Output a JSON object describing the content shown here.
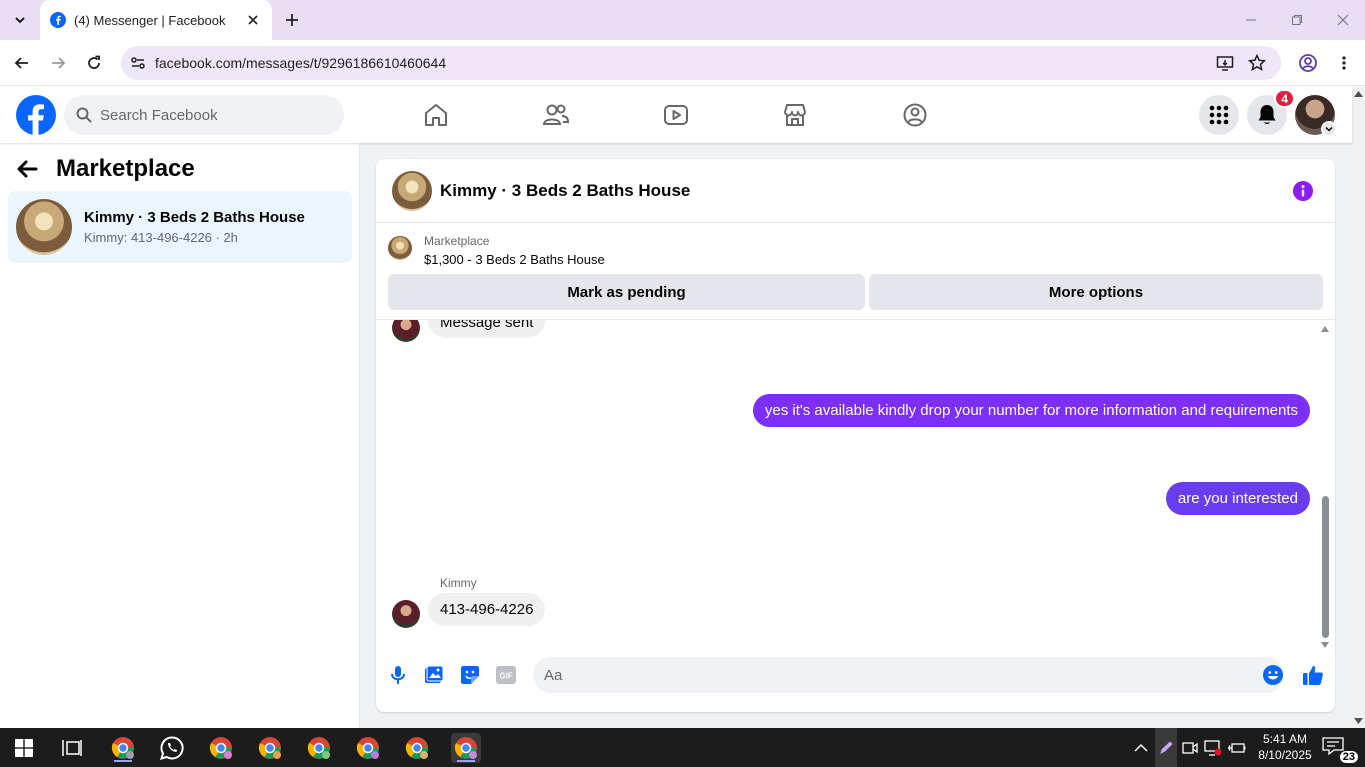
{
  "browser": {
    "tab_title": "(4) Messenger | Facebook",
    "url": "facebook.com/messages/t/9296186610460644"
  },
  "fb": {
    "search_placeholder": "Search Facebook",
    "notification_count": "4",
    "brand_color": "#0866ff"
  },
  "sidebar": {
    "title": "Marketplace",
    "conversation": {
      "name": "Kimmy · 3 Beds 2 Baths House",
      "snippet": "Kimmy: 413-496-4226 · 2h"
    }
  },
  "chat": {
    "title": "Kimmy · 3 Beds 2 Baths House",
    "listing_label": "Marketplace",
    "listing_price": "$1,300 - 3 Beds 2 Baths House",
    "mark_pending_label": "Mark as pending",
    "more_options_label": "More options",
    "accent_color": "#7b2ff7",
    "messages": {
      "partial_incoming": "Message sent",
      "outgoing_1": "yes it's available kindly drop your number for more information and requirements",
      "outgoing_2": "are you interested",
      "sender_name": "Kimmy",
      "incoming_last": "413-496-4226"
    },
    "composer_placeholder": "Aa"
  },
  "taskbar": {
    "time": "5:41 AM",
    "date": "8/10/2025",
    "notification_count": "23"
  }
}
